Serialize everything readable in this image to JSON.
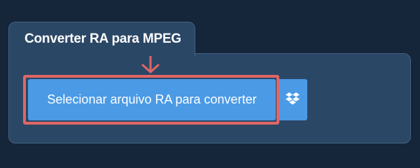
{
  "tab": {
    "title": "Converter RA para MPEG"
  },
  "buttons": {
    "select_file_label": "Selecionar arquivo RA para converter",
    "dropbox_icon": "dropbox-icon"
  },
  "colors": {
    "background": "#15253a",
    "panel": "#2b4766",
    "button": "#4a9ae6",
    "highlight": "#e06666"
  }
}
